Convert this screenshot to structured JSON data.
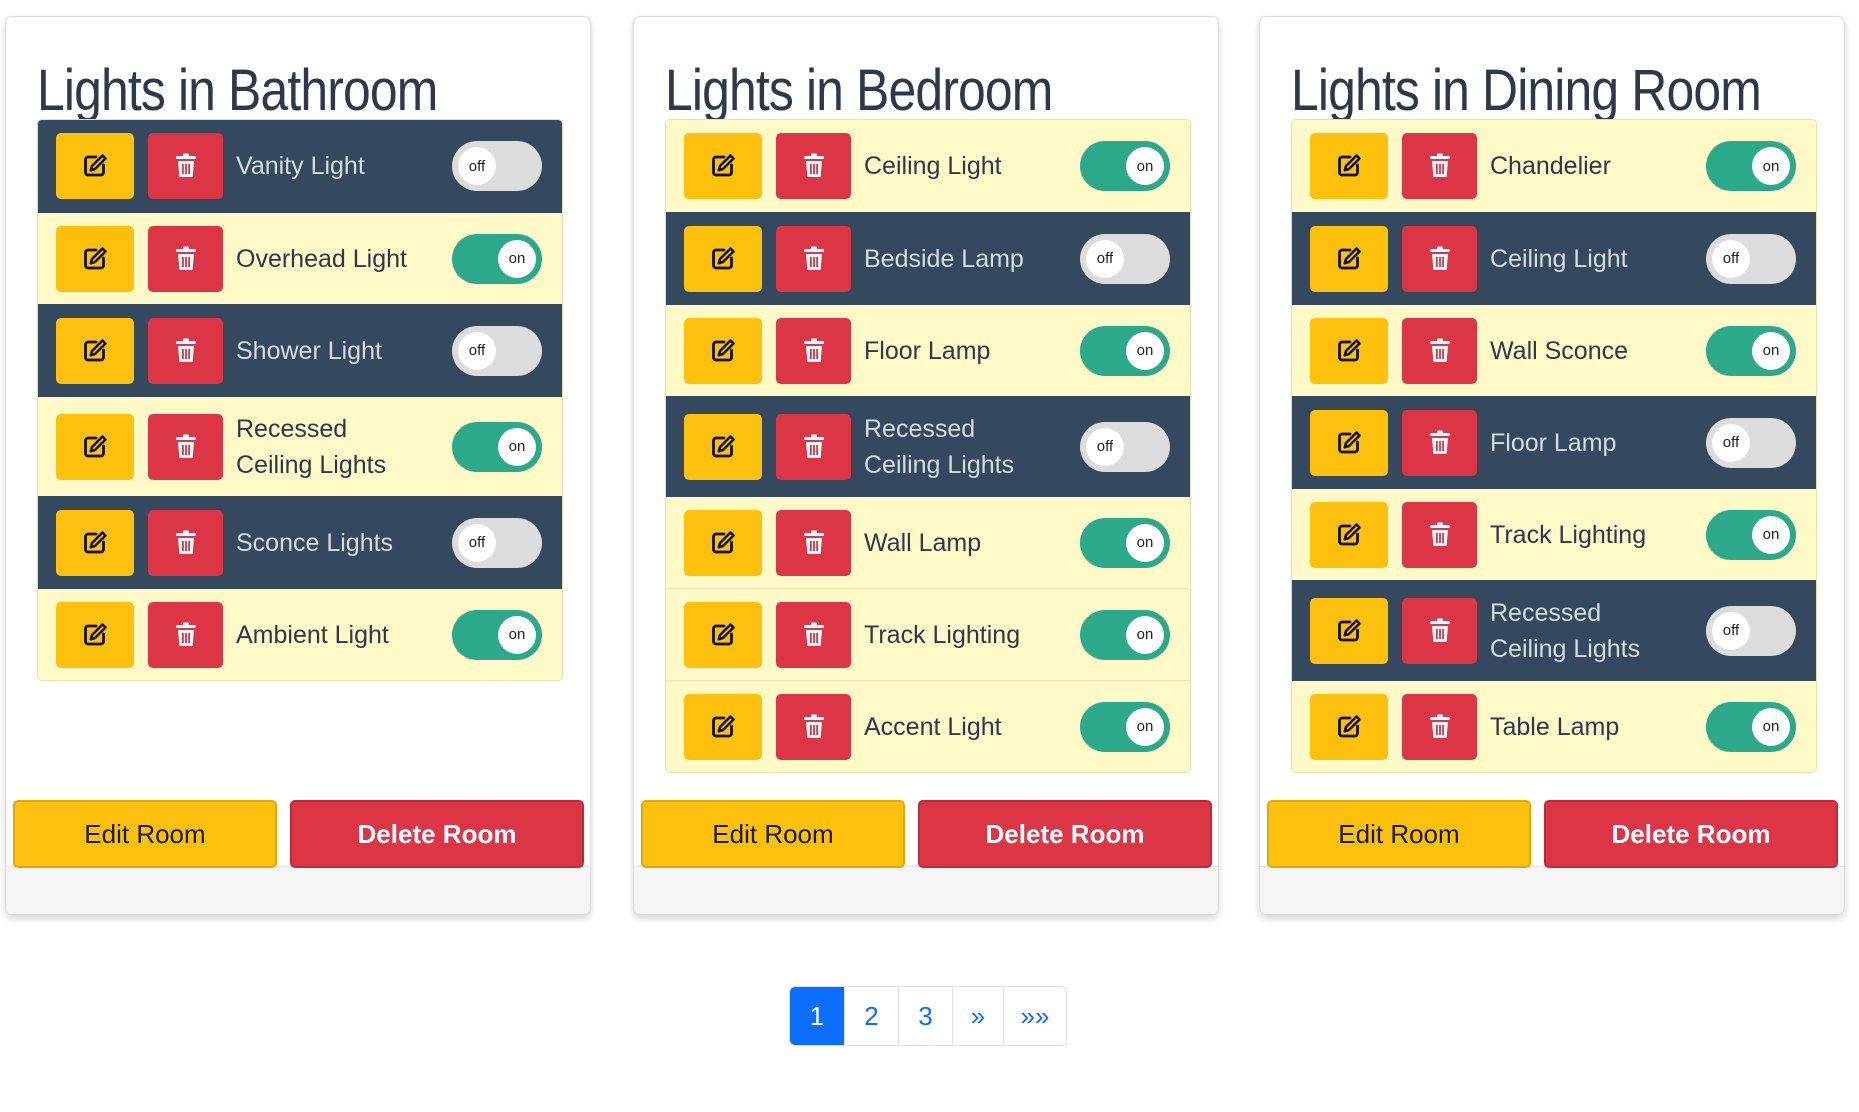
{
  "rooms": [
    {
      "title": "Lights in Bathroom",
      "edit_label": "Edit Room",
      "delete_label": "Delete Room",
      "lights": [
        {
          "name": "Vanity Light",
          "state": "off"
        },
        {
          "name": "Overhead Light",
          "state": "on"
        },
        {
          "name": "Shower Light",
          "state": "off"
        },
        {
          "name": "Recessed Ceiling Lights",
          "state": "on"
        },
        {
          "name": "Sconce Lights",
          "state": "off"
        },
        {
          "name": "Ambient Light",
          "state": "on"
        }
      ]
    },
    {
      "title": "Lights in Bedroom",
      "edit_label": "Edit Room",
      "delete_label": "Delete Room",
      "lights": [
        {
          "name": "Ceiling Light",
          "state": "on"
        },
        {
          "name": "Bedside Lamp",
          "state": "off"
        },
        {
          "name": "Floor Lamp",
          "state": "on"
        },
        {
          "name": "Recessed Ceiling Lights",
          "state": "off"
        },
        {
          "name": "Wall Lamp",
          "state": "on"
        },
        {
          "name": "Track Lighting",
          "state": "on"
        },
        {
          "name": "Accent Light",
          "state": "on"
        }
      ]
    },
    {
      "title": "Lights in Dining Room",
      "edit_label": "Edit Room",
      "delete_label": "Delete Room",
      "lights": [
        {
          "name": "Chandelier",
          "state": "on"
        },
        {
          "name": "Ceiling Light",
          "state": "off"
        },
        {
          "name": "Wall Sconce",
          "state": "on"
        },
        {
          "name": "Floor Lamp",
          "state": "off"
        },
        {
          "name": "Track Lighting",
          "state": "on"
        },
        {
          "name": "Recessed Ceiling Lights",
          "state": "off"
        },
        {
          "name": "Table Lamp",
          "state": "on"
        }
      ]
    }
  ],
  "icons": {
    "edit": "edit-icon",
    "delete": "trash-icon"
  },
  "colors": {
    "edit": "#fdc10d",
    "delete": "#dc3545",
    "row_on": "#fff9c8",
    "row_off": "#34495e",
    "toggle_on": "#2ba98a",
    "toggle_off": "#dcdcdc",
    "page_active": "#0d6efd"
  },
  "pagination": {
    "pages": [
      "1",
      "2",
      "3",
      "»",
      "»»"
    ],
    "active": "1"
  }
}
